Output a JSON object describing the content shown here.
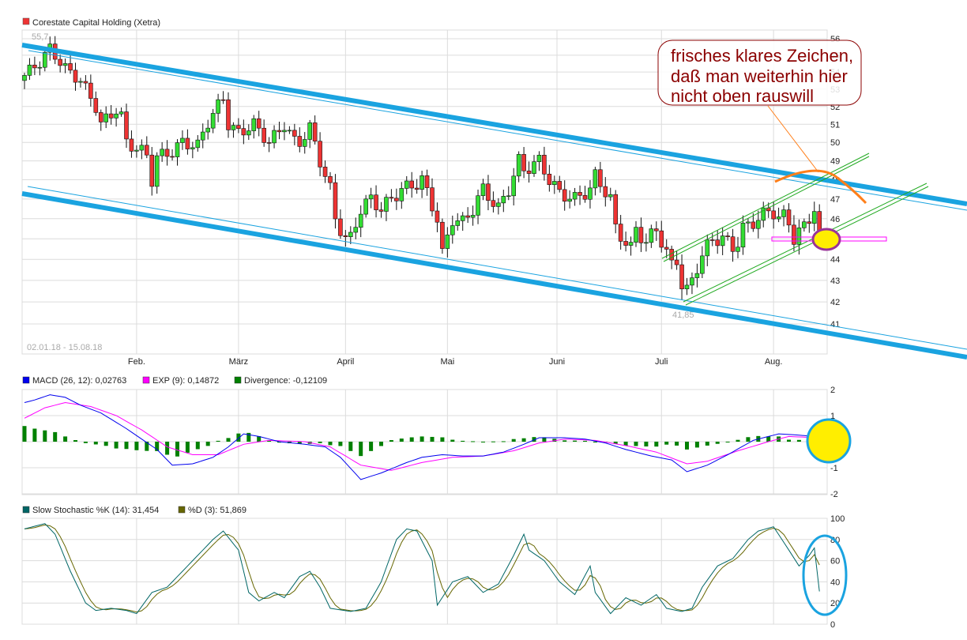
{
  "colors": {
    "up": "#33dd33",
    "down": "#ee3333",
    "trend": "#1aa3e0",
    "channel": "#22aa22",
    "macd": "#0000ee",
    "signal": "#ff00ff",
    "divergence": "#008000",
    "k": "#006666",
    "d": "#666600",
    "note": "#8b0000",
    "orange": "#ff7f1a",
    "highlight": "#ffee00",
    "purple": "#993399"
  },
  "chart_data": [
    {
      "type": "candlestick",
      "title": "Corestate Capital Holding (Xetra)",
      "date_range": "02.01.18 - 15.08.18",
      "ylim": [
        41,
        56
      ],
      "yticks": [
        56,
        55,
        54,
        53,
        52,
        51,
        50,
        49,
        48,
        47,
        46,
        45,
        44,
        43,
        42,
        41
      ],
      "scale": "log",
      "month_ticks": [
        {
          "label": "Feb.",
          "day": 22
        },
        {
          "label": "März",
          "day": 42
        },
        {
          "label": "April",
          "day": 63
        },
        {
          "label": "Mai",
          "day": 83
        },
        {
          "label": "Juni",
          "day": 104.5
        },
        {
          "label": "Juli",
          "day": 125
        },
        {
          "label": "Aug.",
          "day": 147
        }
      ],
      "days": 157,
      "high_label": "55,7",
      "low_label": "41,85",
      "close_keypoints": [
        [
          0,
          53.8
        ],
        [
          3,
          54.6
        ],
        [
          5,
          55.4
        ],
        [
          8,
          54.2
        ],
        [
          11,
          53.5
        ],
        [
          14,
          52
        ],
        [
          15,
          51
        ],
        [
          18.6,
          52
        ],
        [
          20,
          50
        ],
        [
          22.5,
          49.6
        ],
        [
          24,
          49.3
        ],
        [
          25,
          48
        ],
        [
          26,
          49.2
        ],
        [
          29,
          49.5
        ],
        [
          31,
          50
        ],
        [
          34,
          49.8
        ],
        [
          35.7,
          51
        ],
        [
          39,
          52.5
        ],
        [
          40,
          51
        ],
        [
          42,
          50.5
        ],
        [
          45,
          51
        ],
        [
          48,
          50
        ],
        [
          49.6,
          50.5
        ],
        [
          51,
          51
        ],
        [
          53.5,
          49.8
        ],
        [
          56,
          50.8
        ],
        [
          58,
          49
        ],
        [
          60,
          47.5
        ],
        [
          61,
          46
        ],
        [
          63,
          45
        ],
        [
          64,
          45
        ],
        [
          66,
          46.5
        ],
        [
          68,
          47
        ],
        [
          70,
          46.5
        ],
        [
          72,
          47
        ],
        [
          74,
          47.5
        ],
        [
          77,
          47.8
        ],
        [
          78,
          48
        ],
        [
          81,
          46
        ],
        [
          82,
          44.2
        ],
        [
          84,
          46
        ],
        [
          86,
          45.8
        ],
        [
          88,
          46.5
        ],
        [
          90,
          47.5
        ],
        [
          93,
          46.5
        ],
        [
          95,
          47.5
        ],
        [
          97,
          49
        ],
        [
          98,
          48.5
        ],
        [
          101,
          49
        ],
        [
          103,
          48
        ],
        [
          105,
          47.3
        ],
        [
          108,
          47
        ],
        [
          111,
          47.5
        ],
        [
          112,
          48.2
        ],
        [
          115,
          47
        ],
        [
          116,
          45.5
        ],
        [
          119,
          44.5
        ],
        [
          120,
          45.5
        ],
        [
          122,
          44.8
        ],
        [
          124,
          45.5
        ],
        [
          127,
          43.7
        ],
        [
          128,
          44
        ],
        [
          129.5,
          42.2
        ],
        [
          131,
          43
        ],
        [
          132.5,
          44
        ],
        [
          135,
          45
        ],
        [
          137,
          45
        ],
        [
          139.5,
          44.5
        ],
        [
          141,
          45.5
        ],
        [
          144,
          46
        ],
        [
          146.5,
          46.5
        ],
        [
          148,
          46
        ],
        [
          149.6,
          46.2
        ],
        [
          151,
          45
        ],
        [
          152.7,
          45.5
        ],
        [
          155,
          46.5
        ],
        [
          156,
          44.6
        ]
      ]
    },
    {
      "type": "line",
      "title": "MACD",
      "legend": [
        {
          "label": "MACD (26, 12): 0,02763",
          "color": "#0000ee"
        },
        {
          "label": "EXP (9): 0,14872",
          "color": "#ff00ff"
        },
        {
          "label": "Divergence: -0,12109",
          "color": "#008000"
        }
      ],
      "ylim": [
        -2,
        2
      ],
      "yticks": [
        "2",
        "1",
        "0",
        "-1",
        "-2"
      ],
      "macd_keypoints": [
        [
          0,
          1.5
        ],
        [
          2,
          1.6
        ],
        [
          5,
          1.8
        ],
        [
          8,
          1.7
        ],
        [
          11,
          1.4
        ],
        [
          15,
          1.1
        ],
        [
          20,
          0.5
        ],
        [
          23,
          0.1
        ],
        [
          26,
          -0.3
        ],
        [
          29,
          -0.9
        ],
        [
          33,
          -0.85
        ],
        [
          37,
          -0.6
        ],
        [
          40,
          -0.2
        ],
        [
          43,
          0.3
        ],
        [
          46,
          0.2
        ],
        [
          50,
          0.0
        ],
        [
          55,
          -0.1
        ],
        [
          59,
          -0.2
        ],
        [
          62,
          -0.6
        ],
        [
          66,
          -1.45
        ],
        [
          70,
          -1.2
        ],
        [
          75,
          -0.8
        ],
        [
          78,
          -0.6
        ],
        [
          82,
          -0.5
        ],
        [
          86,
          -0.55
        ],
        [
          90,
          -0.55
        ],
        [
          94,
          -0.4
        ],
        [
          98,
          -0.1
        ],
        [
          101,
          0.15
        ],
        [
          106,
          0.15
        ],
        [
          110,
          0.1
        ],
        [
          114,
          -0.05
        ],
        [
          118,
          -0.3
        ],
        [
          123,
          -0.55
        ],
        [
          127,
          -0.7
        ],
        [
          130,
          -1.15
        ],
        [
          134,
          -0.9
        ],
        [
          138,
          -0.5
        ],
        [
          143,
          0.05
        ],
        [
          148,
          0.3
        ],
        [
          152,
          0.25
        ],
        [
          155,
          0.2
        ],
        [
          156,
          0.03
        ]
      ],
      "signal_keypoints": [
        [
          0,
          0.9
        ],
        [
          4,
          1.3
        ],
        [
          8,
          1.5
        ],
        [
          13,
          1.35
        ],
        [
          18,
          1.0
        ],
        [
          23,
          0.45
        ],
        [
          28,
          -0.2
        ],
        [
          33,
          -0.5
        ],
        [
          38,
          -0.5
        ],
        [
          43,
          -0.1
        ],
        [
          48,
          0.05
        ],
        [
          55,
          0.0
        ],
        [
          60,
          -0.2
        ],
        [
          66,
          -0.9
        ],
        [
          72,
          -1.1
        ],
        [
          78,
          -0.8
        ],
        [
          84,
          -0.6
        ],
        [
          90,
          -0.55
        ],
        [
          96,
          -0.35
        ],
        [
          101,
          -0.05
        ],
        [
          106,
          0.1
        ],
        [
          112,
          0.05
        ],
        [
          118,
          -0.15
        ],
        [
          124,
          -0.4
        ],
        [
          130,
          -0.85
        ],
        [
          134,
          -0.75
        ],
        [
          140,
          -0.35
        ],
        [
          146,
          0.0
        ],
        [
          150,
          0.2
        ],
        [
          156,
          0.15
        ]
      ]
    },
    {
      "type": "line",
      "title": "Slow Stochastic",
      "legend": [
        {
          "label": "Slow Stochastic %K (14): 31,454",
          "color": "#006666"
        },
        {
          "label": "%D (3): 51,869",
          "color": "#666600"
        }
      ],
      "ylim": [
        0,
        100
      ],
      "yticks": [
        "100",
        "80",
        "60",
        "40",
        "20",
        "0"
      ],
      "k_keypoints": [
        [
          0,
          90
        ],
        [
          4,
          95
        ],
        [
          6,
          85
        ],
        [
          9,
          50
        ],
        [
          12,
          20
        ],
        [
          14,
          13
        ],
        [
          17,
          15
        ],
        [
          20,
          13
        ],
        [
          22,
          10
        ],
        [
          25,
          30
        ],
        [
          28,
          35
        ],
        [
          32,
          55
        ],
        [
          37,
          80
        ],
        [
          39,
          88
        ],
        [
          42,
          70
        ],
        [
          44,
          30
        ],
        [
          46,
          22
        ],
        [
          49,
          30
        ],
        [
          51,
          25
        ],
        [
          54,
          45
        ],
        [
          56,
          50
        ],
        [
          58,
          35
        ],
        [
          60,
          15
        ],
        [
          64,
          12
        ],
        [
          67,
          15
        ],
        [
          70,
          40
        ],
        [
          73,
          80
        ],
        [
          75,
          90
        ],
        [
          77,
          88
        ],
        [
          80,
          60
        ],
        [
          81,
          18
        ],
        [
          84,
          40
        ],
        [
          87,
          45
        ],
        [
          90,
          30
        ],
        [
          93,
          38
        ],
        [
          96,
          65
        ],
        [
          98,
          85
        ],
        [
          99,
          70
        ],
        [
          102,
          60
        ],
        [
          105,
          40
        ],
        [
          108,
          28
        ],
        [
          111,
          55
        ],
        [
          112,
          30
        ],
        [
          115,
          10
        ],
        [
          118,
          25
        ],
        [
          121,
          18
        ],
        [
          124,
          28
        ],
        [
          126,
          15
        ],
        [
          129,
          12
        ],
        [
          131,
          15
        ],
        [
          133,
          35
        ],
        [
          136,
          55
        ],
        [
          139,
          62
        ],
        [
          142,
          80
        ],
        [
          144,
          88
        ],
        [
          147,
          92
        ],
        [
          150,
          70
        ],
        [
          152,
          55
        ],
        [
          154,
          65
        ],
        [
          155,
          72
        ],
        [
          156,
          31
        ]
      ]
    }
  ],
  "annotation": {
    "line1": "frisches klares Zeichen,",
    "line2": "daß man weiterhin hier",
    "line3": "nicht oben rauswill"
  }
}
